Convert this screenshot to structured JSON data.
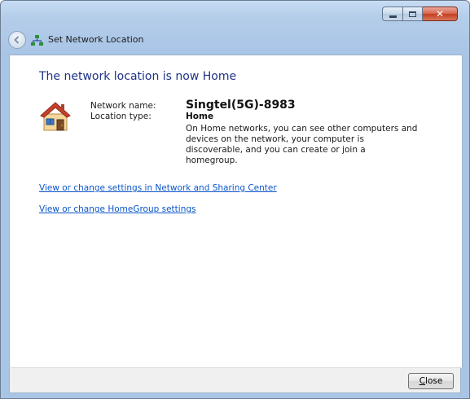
{
  "window": {
    "title": "Set Network Location",
    "accent_color": "#1e3287",
    "icons": {
      "back": "back-arrow-icon",
      "network": "network-icon",
      "minimize": "minimize-icon",
      "maximize": "maximize-icon",
      "close": "close-icon"
    }
  },
  "main": {
    "heading": "The network location is now Home",
    "network_name_label": "Network name:",
    "network_name_value": "Singtel(5G)-8983",
    "location_type_label": "Location type:",
    "location_type_value": "Home",
    "description": "On Home networks, you can see other computers and devices on the network, your computer is discoverable, and you can create or join a homegroup.",
    "house_icon": "home-network-icon",
    "links": [
      {
        "label": "View or change settings in Network and Sharing Center"
      },
      {
        "label": "View or change HomeGroup settings"
      }
    ],
    "link_color": "#0a55c9"
  },
  "footer": {
    "close_label_mnemonic": "C",
    "close_label_rest": "lose"
  }
}
